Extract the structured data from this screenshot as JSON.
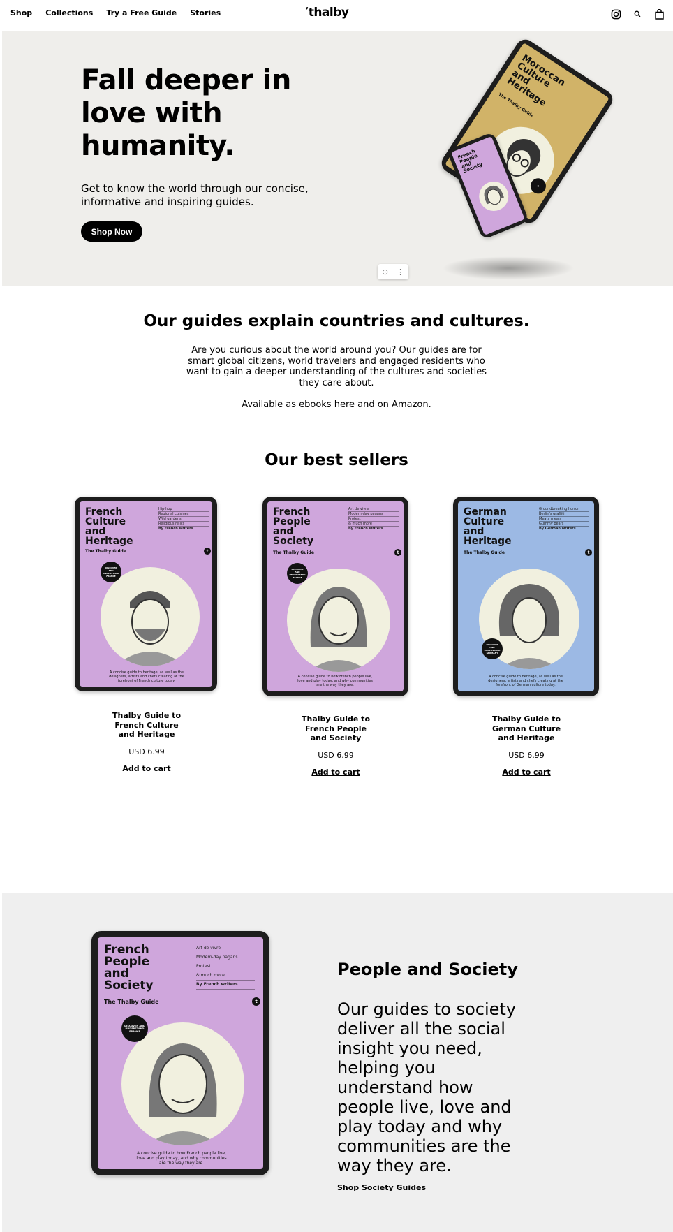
{
  "header": {
    "nav": [
      "Shop",
      "Collections",
      "Try a Free Guide",
      "Stories"
    ],
    "logo": "thalby",
    "icons": [
      "instagram-icon",
      "search-icon",
      "bag-icon"
    ]
  },
  "hero": {
    "title": "Fall deeper in love with humanity.",
    "subtitle": "Get to know the world through our concise, informative and inspiring guides.",
    "cta": "Shop Now",
    "tablet": {
      "title": "Moroccan Culture and Heritage",
      "sub": "The Thalby Guide"
    },
    "phone": {
      "title": "French People and Society"
    }
  },
  "intro": {
    "title": "Our guides explain countries and cultures.",
    "body": "Are you curious about the world around you? Our guides are for smart global citizens, world travelers and engaged residents who want to gain a deeper understanding of the cultures and societies they care about.",
    "available": "Available as ebooks here and on Amazon."
  },
  "best_sellers": {
    "title": "Our best sellers",
    "products": [
      {
        "name": "Thalby Guide to French Culture and Heritage",
        "price": "USD 6.99",
        "cart": "Add to cart",
        "cover": {
          "title": "French Culture and Heritage",
          "sub": "The Thalby Guide",
          "list": [
            "Hip-hop",
            "Regional cuisines",
            "Wild gardens",
            "Religious relics",
            "By French writers"
          ],
          "badge": "DISCOVER AND UNDERSTAND FRANCE",
          "desc": "A concise guide to heritage, as well as the designers, artists and chefs creating at the forefront of French culture today."
        }
      },
      {
        "name": "Thalby Guide to French People and Society",
        "price": "USD 6.99",
        "cart": "Add to cart",
        "cover": {
          "title": "French People and Society",
          "sub": "The Thalby Guide",
          "list": [
            "Art de vivre",
            "Modern-day pagans",
            "Protest",
            "& much more",
            "By French writers"
          ],
          "badge": "DISCOVER AND UNDERSTAND FRANCE",
          "desc": "A concise guide to how French people live, love and play today, and why communities are the way they are."
        }
      },
      {
        "name": "Thalby Guide to German Culture and Heritage",
        "price": "USD 6.99",
        "cart": "Add to cart",
        "cover": {
          "title": "German Culture and Heritage",
          "sub": "The Thalby Guide",
          "list": [
            "Groundbreaking horror",
            "Berlin's graffiti",
            "Meaty meals",
            "Gummy bears",
            "By German writers"
          ],
          "badge": "DISCOVER AND UNDERSTAND GERMANY",
          "desc": "A concise guide to heritage, as well as the designers, artists and chefs creating at the forefront of German culture today."
        }
      }
    ]
  },
  "feature": {
    "title": "People and Society",
    "body": "Our guides to society deliver all the social insight you need, helping you understand how people live, love and play today and why communities are the way they are.",
    "link": "Shop Society Guides",
    "cover": {
      "title": "French People and Society",
      "sub": "The Thalby Guide",
      "list": [
        "Art de vivre",
        "Modern-day pagans",
        "Protest",
        "& much more",
        "By French writers"
      ],
      "badge": "DISCOVER AND UNDERSTAND FRANCE",
      "desc": "A concise guide to how French people live, love and play today, and why communities are the way they are."
    }
  },
  "colors": {
    "purple": "#cfa6dc",
    "blue": "#9cb9e4",
    "gold": "#d1b368",
    "hero_bg": "#efeeeb"
  }
}
